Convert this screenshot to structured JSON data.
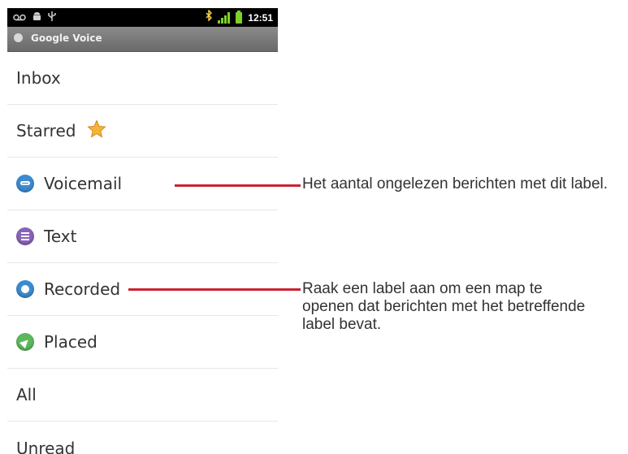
{
  "status_bar": {
    "time": "12:51",
    "left_icons": [
      "voicemail-icon",
      "android-debug-icon",
      "usb-icon"
    ],
    "right_icons": [
      "bluetooth-icon",
      "signal-icon",
      "battery-icon"
    ]
  },
  "app": {
    "title": "Google Voice",
    "logo": "google-voice-logo-icon"
  },
  "labels": [
    {
      "name": "Inbox",
      "icon": null
    },
    {
      "name": "Starred",
      "icon": "star-icon"
    },
    {
      "name": "Voicemail",
      "icon": "voicemail-icon",
      "color": "#3b8bd0"
    },
    {
      "name": "Text",
      "icon": "text-icon",
      "color": "#8a63b8"
    },
    {
      "name": "Recorded",
      "icon": "recorded-icon",
      "color": "#3b8bd0"
    },
    {
      "name": "Placed",
      "icon": "placed-icon",
      "color": "#5cb85c"
    },
    {
      "name": "All",
      "icon": null
    },
    {
      "name": "Unread",
      "icon": null
    }
  ],
  "callouts": {
    "unread_count": "Het aantal ongelezen berichten met dit label.",
    "open_label": "Raak een label aan om een map te openen dat berichten met het betreffende label bevat."
  },
  "colors": {
    "callout_line": "#cc2233",
    "status_bar": "#000000",
    "title_bar": "#7a7a7a"
  }
}
